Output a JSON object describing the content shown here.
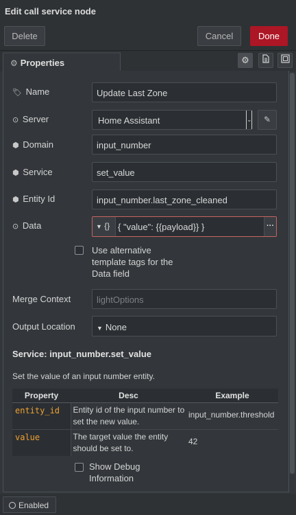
{
  "dialog": {
    "title": "Edit call service node"
  },
  "buttons": {
    "delete": "Delete",
    "cancel": "Cancel",
    "done": "Done"
  },
  "tabs": {
    "properties": "Properties"
  },
  "fields": {
    "name": {
      "label": "Name",
      "value": "Update Last Zone"
    },
    "server": {
      "label": "Server",
      "value": "Home Assistant"
    },
    "domain": {
      "label": "Domain",
      "value": "input_number"
    },
    "service": {
      "label": "Service",
      "value": "set_value"
    },
    "entity_id": {
      "label": "Entity Id",
      "value": "input_number.last_zone_cleaned"
    },
    "data": {
      "label": "Data",
      "type_icon": "{}",
      "value": "{ \"value\": {{payload}} }"
    },
    "alt_tags": {
      "lines": [
        "Use alternative",
        "template tags for the",
        "Data field"
      ]
    },
    "merge_context": {
      "label": "Merge Context",
      "placeholder": "lightOptions"
    },
    "output_location": {
      "label": "Output Location",
      "value": "None"
    }
  },
  "service_info": {
    "title": "Service: input_number.set_value",
    "description": "Set the value of an input number entity.",
    "columns": [
      "Property",
      "Desc",
      "Example"
    ],
    "rows": [
      {
        "property": "entity_id",
        "desc": "Entity id of the input number to set the new value.",
        "example": "input_number.threshold"
      },
      {
        "property": "value",
        "desc": "The target value the entity should be set to.",
        "example": "42"
      }
    ]
  },
  "debug": {
    "lines": [
      "Show Debug",
      "Information"
    ]
  },
  "footer": {
    "enabled": "Enabled"
  }
}
